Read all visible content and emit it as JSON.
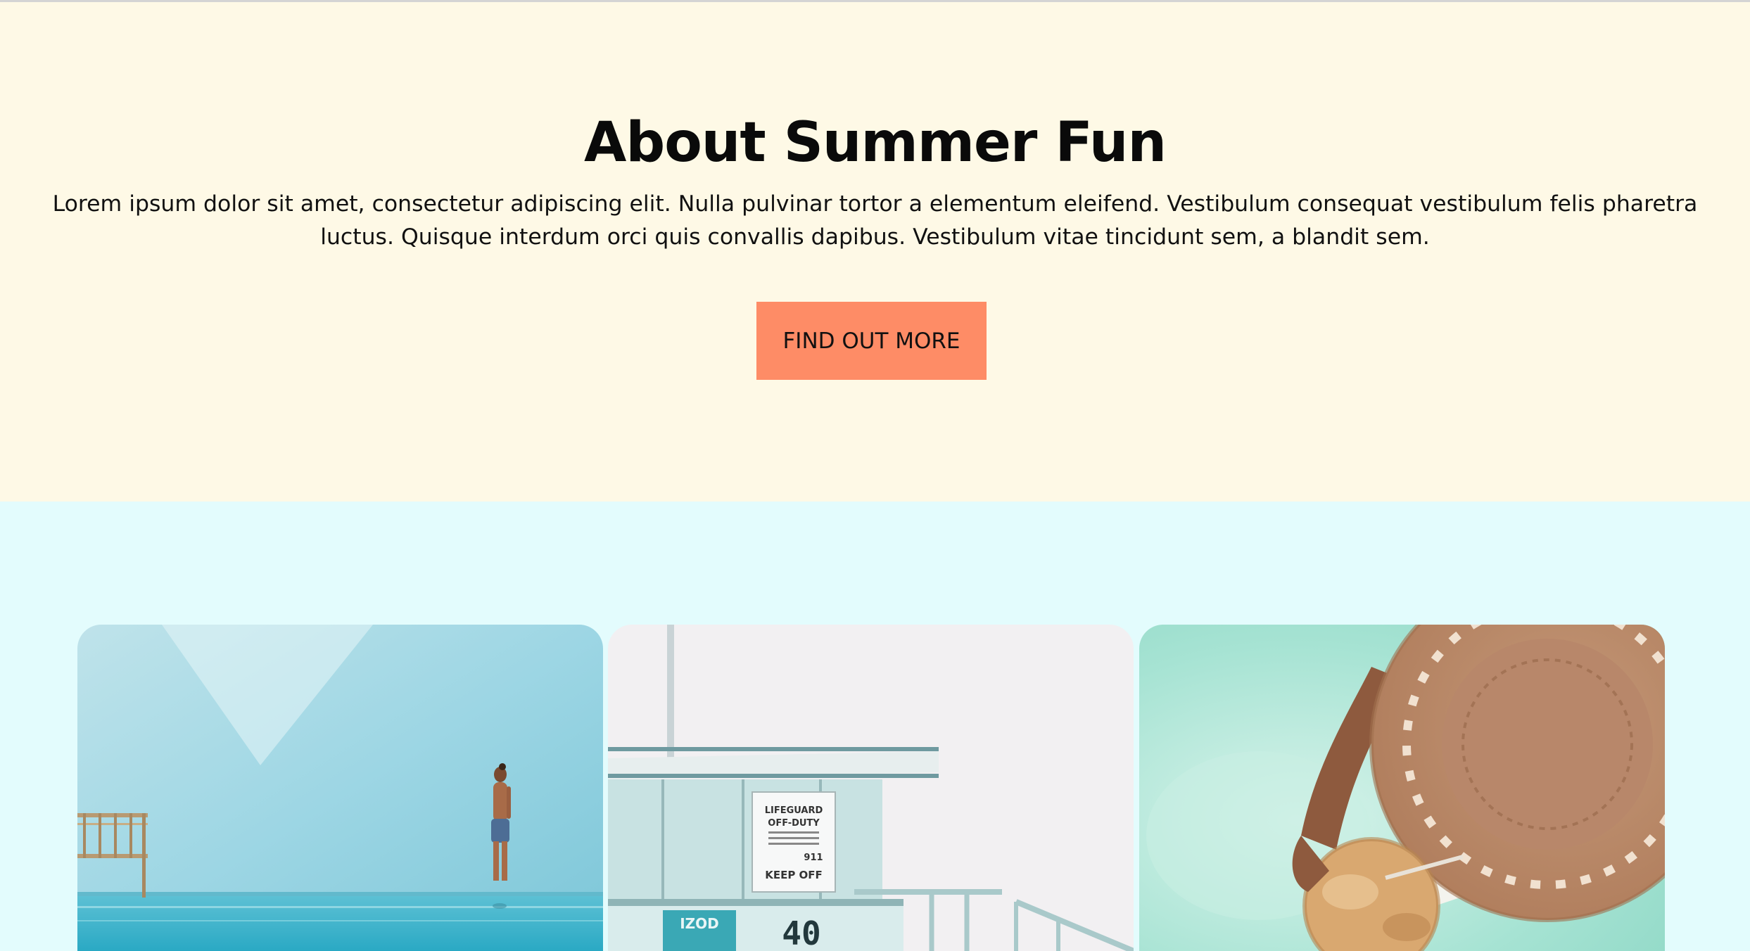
{
  "about": {
    "title": "About Summer Fun",
    "body": "Lorem ipsum dolor sit amet, consectetur adipiscing elit. Nulla pulvinar tortor a elementum eleifend. Vestibulum consequat vestibulum felis pharetra luctus. Quisque interdum orci quis convallis dapibus. Vestibulum vitae tincidunt sem, a blandit sem.",
    "button_label": "FIND OUT MORE"
  },
  "gallery": {
    "photos": [
      {
        "subject": "man-walking-on-infinity-pool"
      },
      {
        "subject": "lifeguard-tower",
        "sign_lines": [
          "LIFEGUARD",
          "OFF-DUTY",
          "911",
          "KEEP OFF"
        ],
        "tower_number": "40",
        "tower_brand": "IZOD"
      },
      {
        "subject": "straw-hat-and-coconut-drink"
      }
    ]
  },
  "colors": {
    "about_bg": "#fef9e6",
    "gallery_bg": "#e3fcfd",
    "button_bg": "#fe8c66"
  }
}
